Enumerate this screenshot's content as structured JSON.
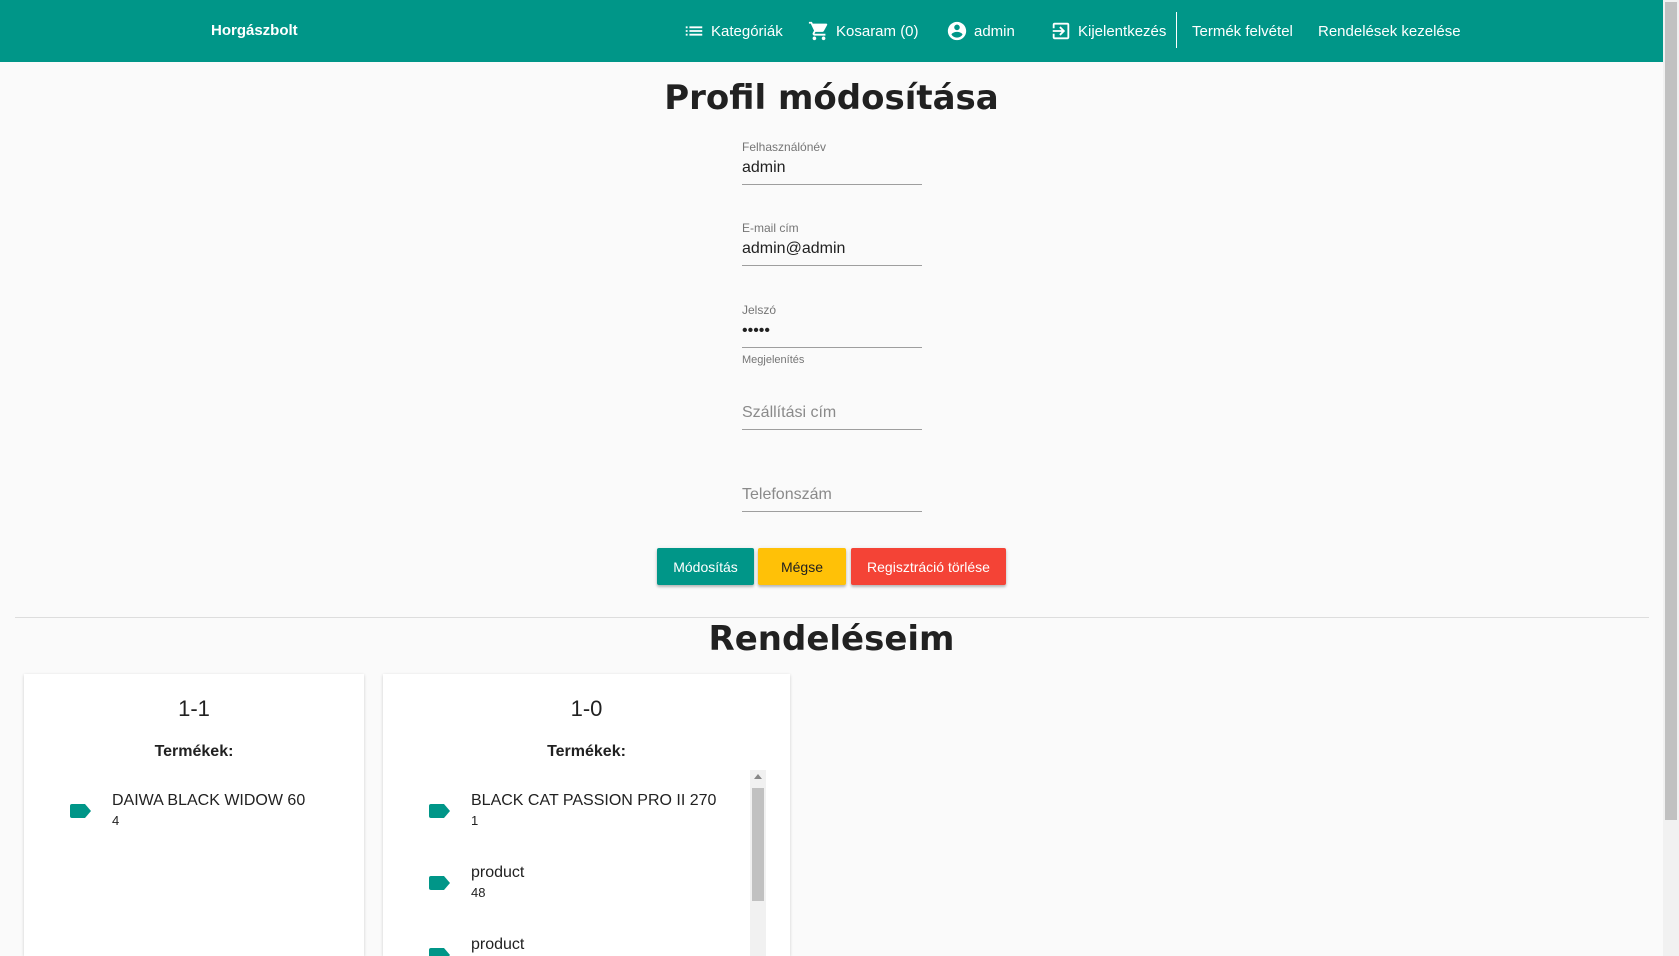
{
  "nav": {
    "brand": "Horgászbolt",
    "categories": "Kategóriák",
    "cart": "Kosaram (0)",
    "user": "admin",
    "logout": "Kijelentkezés",
    "add_product": "Termék felvétel",
    "manage_orders": "Rendelések kezelése"
  },
  "profile": {
    "title": "Profil módosítása",
    "username_label": "Felhasználónév",
    "username_value": "admin",
    "email_label": "E-mail cím",
    "email_value": "admin@admin",
    "password_label": "Jelszó",
    "password_value": "•••••",
    "show_password": "Megjelenítés",
    "address_placeholder": "Szállítási cím",
    "phone_placeholder": "Telefonszám",
    "save_button": "Módosítás",
    "cancel_button": "Mégse",
    "delete_button": "Regisztráció törlése"
  },
  "orders": {
    "title": "Rendeléseim",
    "products_label": "Termékek:",
    "list": [
      {
        "id": "1-1",
        "items": [
          {
            "name": "DAIWA BLACK WIDOW 60",
            "qty": "4"
          }
        ]
      },
      {
        "id": "1-0",
        "items": [
          {
            "name": "BLACK CAT PASSION PRO II 270",
            "qty": "1"
          },
          {
            "name": "product",
            "qty": "48"
          },
          {
            "name": "product",
            "qty": ""
          }
        ]
      }
    ]
  },
  "colors": {
    "primary": "#009688",
    "warning": "#ffc107",
    "danger": "#f44336"
  }
}
